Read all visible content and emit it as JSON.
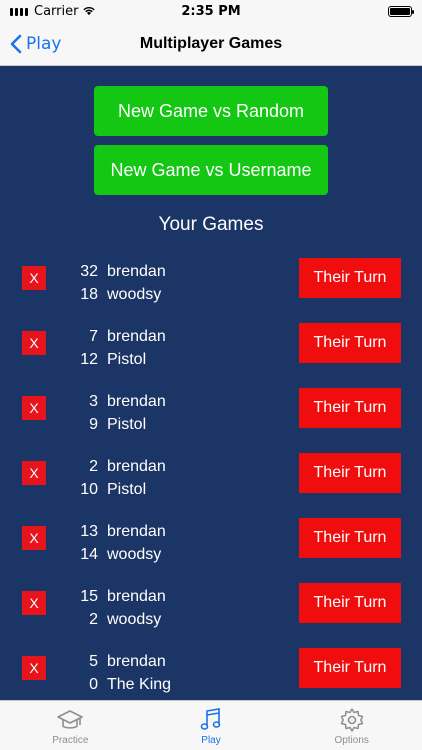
{
  "status_bar": {
    "carrier": "Carrier",
    "time": "2:35 PM"
  },
  "nav": {
    "back_label": "Play",
    "title": "Multiplayer Games"
  },
  "buttons": {
    "new_random": "New Game vs Random",
    "new_username": "New Game vs Username"
  },
  "section_title": "Your Games",
  "games": [
    {
      "delete": "X",
      "my_score": "32",
      "my_name": "brendan",
      "opp_score": "18",
      "opp_name": "woodsy",
      "turn": "Their Turn"
    },
    {
      "delete": "X",
      "my_score": "7",
      "my_name": "brendan",
      "opp_score": "12",
      "opp_name": "Pistol",
      "turn": "Their Turn"
    },
    {
      "delete": "X",
      "my_score": "3",
      "my_name": "brendan",
      "opp_score": "9",
      "opp_name": "Pistol",
      "turn": "Their Turn"
    },
    {
      "delete": "X",
      "my_score": "2",
      "my_name": "brendan",
      "opp_score": "10",
      "opp_name": "Pistol",
      "turn": "Their Turn"
    },
    {
      "delete": "X",
      "my_score": "13",
      "my_name": "brendan",
      "opp_score": "14",
      "opp_name": "woodsy",
      "turn": "Their Turn"
    },
    {
      "delete": "X",
      "my_score": "15",
      "my_name": "brendan",
      "opp_score": "2",
      "opp_name": "woodsy",
      "turn": "Their Turn"
    },
    {
      "delete": "X",
      "my_score": "5",
      "my_name": "brendan",
      "opp_score": "0",
      "opp_name": "The King",
      "turn": "Their Turn"
    }
  ],
  "tabs": [
    {
      "label": "Practice",
      "icon": "graduation-cap-icon",
      "active": false
    },
    {
      "label": "Play",
      "icon": "music-note-icon",
      "active": true
    },
    {
      "label": "Options",
      "icon": "gear-icon",
      "active": false
    }
  ],
  "colors": {
    "background": "#1b3566",
    "green_button": "#13c713",
    "red_button": "#f00d0d",
    "accent": "#1a73e8"
  }
}
